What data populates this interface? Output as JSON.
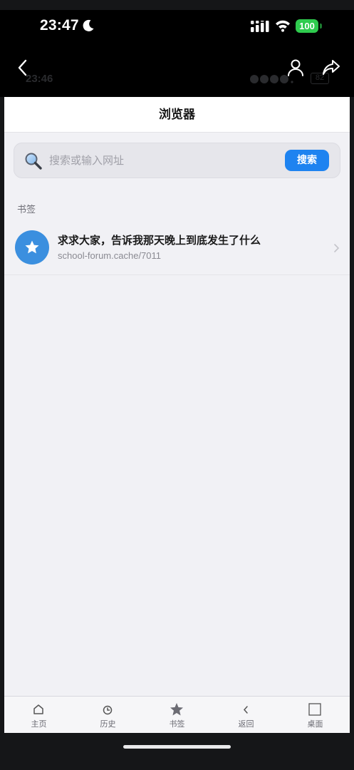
{
  "status_bar": {
    "time": "23:47",
    "battery": "100"
  },
  "header_ghost": {
    "time": "23:46",
    "battery": "82"
  },
  "browser": {
    "title": "浏览器",
    "search": {
      "placeholder": "搜索或输入网址",
      "button_label": "搜索"
    },
    "section_label": "书签",
    "bookmarks": [
      {
        "title": "求求大家，告诉我那天晚上到底发生了什么",
        "url": "school-forum.cache/7011"
      }
    ]
  },
  "bottom_nav": [
    {
      "label": "主页",
      "icon": "home-icon"
    },
    {
      "label": "历史",
      "icon": "clock-icon"
    },
    {
      "label": "书签",
      "icon": "star-icon"
    },
    {
      "label": "返回",
      "icon": "chevron-left-icon"
    },
    {
      "label": "桌面",
      "icon": "square-icon"
    }
  ],
  "colors": {
    "accent": "#1e83f0",
    "bookmark_avatar": "#3b8fdf",
    "battery": "#2fcb4e"
  }
}
